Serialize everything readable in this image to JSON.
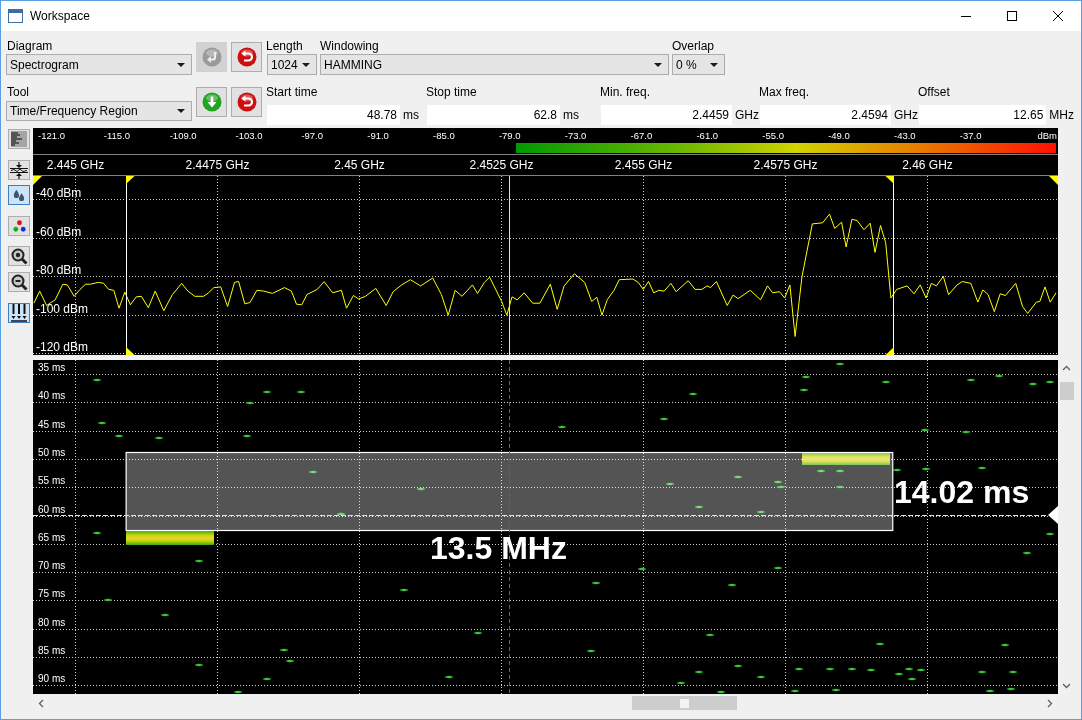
{
  "window": {
    "title": "Workspace"
  },
  "diagram": {
    "label": "Diagram",
    "value": "Spectrogram",
    "buttons": [
      {
        "kind": "enter",
        "disabled": true
      },
      {
        "kind": "undo",
        "disabled": false
      }
    ]
  },
  "length": {
    "label": "Length",
    "value": "1024"
  },
  "windowing": {
    "label": "Windowing",
    "value": "HAMMING"
  },
  "overlap": {
    "label": "Overlap",
    "value": "0 %"
  },
  "tool": {
    "label": "Tool",
    "value": "Time/Frequency Region",
    "buttons": [
      {
        "kind": "down",
        "disabled": false
      },
      {
        "kind": "undo",
        "disabled": false
      }
    ]
  },
  "fields": [
    {
      "label": "Start time",
      "value": "48.78",
      "unit": "ms"
    },
    {
      "label": "Stop time",
      "value": "62.8",
      "unit": "ms"
    },
    {
      "label": "Min. freq.",
      "value": "2.4459",
      "unit": "GHz"
    },
    {
      "label": "Max freq.",
      "value": "2.4594",
      "unit": "GHz"
    },
    {
      "label": "Offset",
      "value": "12.65",
      "unit": "MHz"
    }
  ],
  "side_tools": [
    {
      "kind": "spectrogram",
      "on": false
    },
    {
      "kind": "fit",
      "on": false
    },
    {
      "kind": "drops",
      "on": true
    },
    {
      "kind": "colors",
      "on": false
    },
    {
      "kind": "zoom_in",
      "on": false
    },
    {
      "kind": "zoom_out",
      "on": false
    },
    {
      "kind": "peaks",
      "on": true
    }
  ],
  "color_scale": {
    "labels": [
      "-121.0",
      "-115.0",
      "-109.0",
      "-103.0",
      "-97.0",
      "-91.0",
      "-85.0",
      "-79.0",
      "-73.0",
      "-67.0",
      "-61.0",
      "-55.0",
      "-49.0",
      "-43.0",
      "-37.0"
    ],
    "unit": "dBm"
  },
  "spectrum": {
    "chart_data": {
      "type": "line",
      "grid": true,
      "xlim": [
        2.44426,
        2.46231
      ],
      "ylim": [
        -120.5,
        -27.5
      ],
      "xticks": [
        {
          "value": 2.445,
          "label": "2.445 GHz"
        },
        {
          "value": 2.4475,
          "label": "2.4475 GHz"
        },
        {
          "value": 2.45,
          "label": "2.45 GHz"
        },
        {
          "value": 2.4525,
          "label": "2.4525 GHz"
        },
        {
          "value": 2.455,
          "label": "2.455 GHz"
        },
        {
          "value": 2.4575,
          "label": "2.4575 GHz"
        },
        {
          "value": 2.46,
          "label": "2.46 GHz"
        }
      ],
      "yticks": [
        {
          "value": -40,
          "label": "-40 dBm"
        },
        {
          "value": -60,
          "label": "-60 dBm"
        },
        {
          "value": -80,
          "label": "-80 dBm"
        },
        {
          "value": -100,
          "label": "-100 dBm"
        },
        {
          "value": -120,
          "label": "-120 dBm"
        }
      ],
      "x": [
        2.444275,
        2.444378,
        2.4445,
        2.444651,
        2.444785,
        2.444864,
        2.444985,
        2.445088,
        2.445186,
        2.445271,
        2.44541,
        2.445501,
        2.445592,
        2.445683,
        2.445774,
        2.445877,
        2.445975,
        2.446078,
        2.446169,
        2.44629,
        2.446412,
        2.446563,
        2.446715,
        2.446879,
        2.446988,
        2.44711,
        2.447262,
        2.447353,
        2.447444,
        2.447565,
        2.447687,
        2.447808,
        2.447881,
        2.44799,
        2.448081,
        2.448203,
        2.448324,
        2.448476,
        2.448688,
        2.44881,
        2.448901,
        2.448992,
        2.449083,
        2.449265,
        2.449386,
        2.449538,
        2.44969,
        2.449781,
        2.449902,
        2.449993,
        2.450115,
        2.450297,
        2.450479,
        2.450601,
        2.450752,
        2.450904,
        2.451086,
        2.451299,
        2.451451,
        2.451572,
        2.451693,
        2.451815,
        2.451997,
        2.452088,
        2.452209,
        2.4523,
        2.452513,
        2.452604,
        2.452695,
        2.452786,
        2.452908,
        2.45306,
        2.453187,
        2.453369,
        2.453491,
        2.453612,
        2.453794,
        2.453976,
        2.454098,
        2.454189,
        2.45428,
        2.454371,
        2.454492,
        2.454583,
        2.454826,
        2.454917,
        2.455008,
        2.455099,
        2.45519,
        2.455281,
        2.455373,
        2.455494,
        2.455585,
        2.455798,
        2.455919,
        2.45604,
        2.456131,
        2.456192,
        2.456295,
        2.456484,
        2.456587,
        2.456678,
        2.45689,
        2.457072,
        2.457194,
        2.457285,
        2.457406,
        2.457497,
        2.457588,
        2.45768,
        2.457801,
        2.457983,
        2.458165,
        2.458287,
        2.458378,
        2.458499,
        2.458578,
        2.458681,
        2.458772,
        2.458894,
        2.459003,
        2.459088,
        2.459185,
        2.459276,
        2.459367,
        2.45947,
        2.459653,
        2.459774,
        2.459883,
        2.459987,
        2.460078,
        2.460169,
        2.46029,
        2.460381,
        2.460533,
        2.460624,
        2.460776,
        2.460897,
        2.460988,
        2.461079,
        2.461189,
        2.461292,
        2.461383,
        2.461565,
        2.461686,
        2.461777,
        2.461929,
        2.46199,
        2.462081,
        2.462172,
        2.462275
      ],
      "series": [
        {
          "color": "#ffff00",
          "values": [
            -93.6,
            -87.3,
            -94.8,
            -91.8,
            -83.7,
            -84.1,
            -90.0,
            -86.4,
            -83.7,
            -83.7,
            -82.8,
            -83.2,
            -86.4,
            -86.9,
            -96.2,
            -87.8,
            -94.4,
            -90.3,
            -90.0,
            -95.9,
            -87.3,
            -97.5,
            -89.1,
            -83.3,
            -87.3,
            -90.0,
            -90.0,
            -88.2,
            -85.5,
            -85.1,
            -95.3,
            -82.8,
            -82.3,
            -93.9,
            -93.2,
            -86.9,
            -87.3,
            -88.5,
            -85.5,
            -87.3,
            -94.1,
            -94.4,
            -89.1,
            -86.4,
            -82.4,
            -88.2,
            -86.9,
            -96.2,
            -89.6,
            -91.4,
            -90.0,
            -85.9,
            -94.8,
            -87.6,
            -84.1,
            -81.4,
            -84.6,
            -80.5,
            -89.1,
            -99.8,
            -86.9,
            -90.0,
            -84.1,
            -88.5,
            -82.8,
            -80.1,
            -92.7,
            -99.8,
            -90.3,
            -91.8,
            -88.2,
            -93.6,
            -93.6,
            -83.7,
            -96.8,
            -84.6,
            -78.3,
            -82.8,
            -92.7,
            -90.5,
            -99.8,
            -91.8,
            -86.9,
            -81.4,
            -81.0,
            -82.8,
            -86.4,
            -82.3,
            -88.2,
            -86.9,
            -87.3,
            -83.3,
            -87.6,
            -81.9,
            -86.4,
            -86.4,
            -84.6,
            -85.5,
            -82.3,
            -94.8,
            -89.4,
            -91.2,
            -86.9,
            -91.8,
            -84.6,
            -88.2,
            -87.6,
            -90.9,
            -84.1,
            -110.9,
            -80.1,
            -52.4,
            -51.8,
            -47.3,
            -54.7,
            -51.5,
            -64.4,
            -50.0,
            -50.6,
            -55.4,
            -52.0,
            -67.2,
            -53.2,
            -62.2,
            -90.9,
            -86.4,
            -84.6,
            -88.7,
            -84.1,
            -90.9,
            -83.3,
            -84.6,
            -79.6,
            -89.1,
            -84.1,
            -82.3,
            -83.3,
            -93.0,
            -86.7,
            -89.1,
            -98.0,
            -88.7,
            -89.6,
            -83.3,
            -95.3,
            -98.9,
            -93.0,
            -92.7,
            -85.1,
            -93.0,
            -88.2
          ]
        }
      ],
      "ref_lines": [
        {
          "axis": "x",
          "value": 2.4459,
          "color": "#ffffff"
        },
        {
          "axis": "x",
          "value": 2.4594,
          "color": "#ffffff"
        },
        {
          "axis": "x",
          "value": 2.45265,
          "color": "#ffff00"
        }
      ]
    }
  },
  "waterfall": {
    "time_labels": [
      "35 ms",
      "40 ms",
      "45 ms",
      "50 ms",
      "55 ms",
      "60 ms",
      "65 ms",
      "70 ms",
      "75 ms",
      "80 ms",
      "85 ms",
      "90 ms"
    ],
    "selection": {
      "bandwidth": "13.5 MHz",
      "duration": "14.02 ms"
    }
  }
}
